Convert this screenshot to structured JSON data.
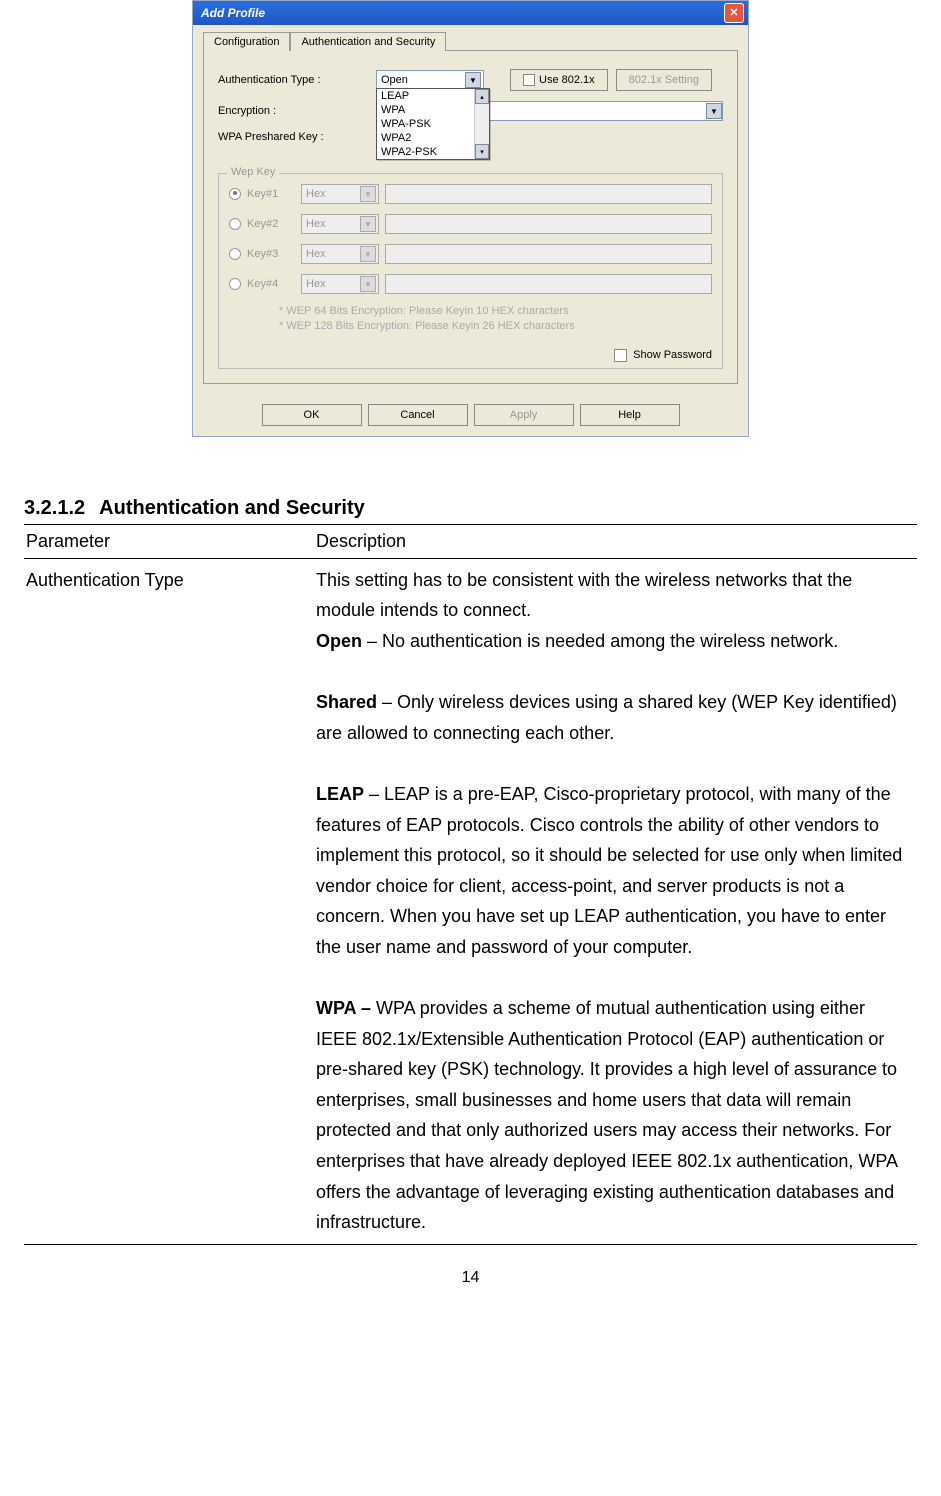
{
  "window": {
    "title": "Add Profile",
    "tabs": {
      "config": "Configuration",
      "auth": "Authentication and Security"
    },
    "labels": {
      "authType": "Authentication Type :",
      "encryption": "Encryption :",
      "psk": "WPA Preshared Key :"
    },
    "authTypeValue": "Open",
    "use8021x": "Use 802.1x",
    "setting8021x": "802.1x Setting",
    "dropdownOptions": [
      "LEAP",
      "WPA",
      "WPA-PSK",
      "WPA2",
      "WPA2-PSK"
    ],
    "wep": {
      "title": "Wep Key",
      "keys": [
        "Key#1",
        "Key#2",
        "Key#3",
        "Key#4"
      ],
      "hex": "Hex",
      "hint1": "* WEP 64 Bits Encryption:   Please Keyin 10 HEX characters",
      "hint2": "* WEP 128 Bits Encryption:  Please Keyin 26 HEX characters"
    },
    "showPassword": "Show Password",
    "buttons": {
      "ok": "OK",
      "cancel": "Cancel",
      "apply": "Apply",
      "help": "Help"
    }
  },
  "doc": {
    "sectionNum": "3.2.1.2",
    "sectionTitle": "Authentication and Security",
    "th1": "Parameter",
    "th2": "Description",
    "row1Param": "Authentication Type",
    "row1_intro": "This setting has to be consistent with the wireless networks that the module intends to connect.",
    "open_b": "Open",
    "open_t": " – No authentication is needed among the wireless network.",
    "shared_b": "Shared",
    "shared_t": " – Only wireless devices using a shared key (WEP Key identified) are allowed to connecting each other.",
    "leap_b": "LEAP",
    "leap_t": " – LEAP is a pre-EAP, Cisco-proprietary protocol, with many of the features of EAP protocols. Cisco controls the ability of other vendors to implement this protocol, so it should be selected for use only when limited vendor choice for client, access-point, and server products is not a concern. When you have set up LEAP authentication, you have to enter the user name and password of your computer.",
    "wpa_b": "WPA –",
    "wpa_t": " WPA provides a scheme of mutual authentication using either IEEE 802.1x/Extensible Authentication Protocol (EAP) authentication or pre-shared key (PSK) technology. It provides a high level of assurance to enterprises, small businesses and home users that data will remain protected and that only authorized users may access their networks. For enterprises that have already deployed IEEE 802.1x authentication, WPA offers the advantage of leveraging existing authentication databases and infrastructure.",
    "pageNum": "14"
  }
}
